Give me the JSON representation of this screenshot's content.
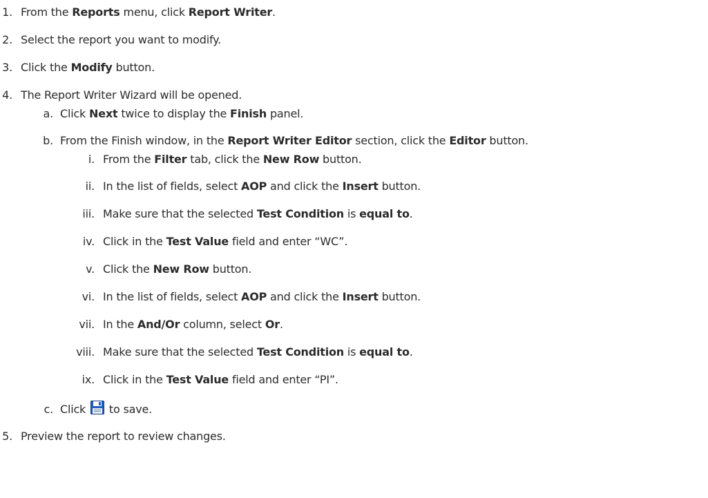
{
  "steps": [
    {
      "num": "1.",
      "parts": [
        [
          "From the ",
          false
        ],
        [
          "Reports",
          true
        ],
        [
          " menu, click ",
          false
        ],
        [
          "Report Writer",
          true
        ],
        [
          ".",
          false
        ]
      ]
    },
    {
      "num": "2.",
      "parts": [
        [
          "Select the report you want to modify.",
          false
        ]
      ]
    },
    {
      "num": "3.",
      "parts": [
        [
          "Click the ",
          false
        ],
        [
          "Modify",
          true
        ],
        [
          " button.",
          false
        ]
      ]
    },
    {
      "num": "4.",
      "parts": [
        [
          "The Report Writer Wizard will be opened.",
          false
        ]
      ]
    },
    {
      "num": "a.",
      "parts": [
        [
          "Click ",
          false
        ],
        [
          "Next",
          true
        ],
        [
          " twice to display the ",
          false
        ],
        [
          "Finish",
          true
        ],
        [
          " panel.",
          false
        ]
      ]
    },
    {
      "num": "b.",
      "parts": [
        [
          "From the Finish window, in the ",
          false
        ],
        [
          "Report Writer Editor",
          true
        ],
        [
          " section, click the ",
          false
        ],
        [
          "Editor",
          true
        ],
        [
          " button.",
          false
        ]
      ]
    },
    {
      "num": "i.",
      "parts": [
        [
          "From the ",
          false
        ],
        [
          "Filter",
          true
        ],
        [
          " tab, click the ",
          false
        ],
        [
          "New Row",
          true
        ],
        [
          " button.",
          false
        ]
      ]
    },
    {
      "num": "ii.",
      "parts": [
        [
          "In the list of fields, select ",
          false
        ],
        [
          "AOP",
          true
        ],
        [
          " and click the ",
          false
        ],
        [
          "Insert",
          true
        ],
        [
          " button.",
          false
        ]
      ]
    },
    {
      "num": "iii.",
      "parts": [
        [
          "Make sure that the selected ",
          false
        ],
        [
          "Test Condition",
          true
        ],
        [
          " is ",
          false
        ],
        [
          "equal to",
          true
        ],
        [
          ".",
          false
        ]
      ]
    },
    {
      "num": "iv.",
      "parts": [
        [
          "Click in the ",
          false
        ],
        [
          "Test Value",
          true
        ],
        [
          " field and enter “WC”.",
          false
        ]
      ]
    },
    {
      "num": "v.",
      "parts": [
        [
          "Click the ",
          false
        ],
        [
          "New Row",
          true
        ],
        [
          " button.",
          false
        ]
      ]
    },
    {
      "num": "vi.",
      "parts": [
        [
          "In the list of fields, select ",
          false
        ],
        [
          "AOP",
          true
        ],
        [
          " and click the ",
          false
        ],
        [
          "Insert",
          true
        ],
        [
          " button.",
          false
        ]
      ]
    },
    {
      "num": "vii.",
      "parts": [
        [
          "In the ",
          false
        ],
        [
          "And/Or",
          true
        ],
        [
          " column, select ",
          false
        ],
        [
          "Or",
          true
        ],
        [
          ".",
          false
        ]
      ]
    },
    {
      "num": "viii.",
      "parts": [
        [
          "Make sure that the selected ",
          false
        ],
        [
          "Test Condition",
          true
        ],
        [
          " is ",
          false
        ],
        [
          "equal to",
          true
        ],
        [
          ".",
          false
        ]
      ]
    },
    {
      "num": "ix.",
      "parts": [
        [
          "Click in the ",
          false
        ],
        [
          "Test Value",
          true
        ],
        [
          " field and enter “PI”.",
          false
        ]
      ]
    },
    {
      "num": "c.",
      "parts": [
        [
          "Click ",
          false
        ],
        [
          "",
          "icon"
        ],
        [
          " to save.",
          false
        ]
      ]
    },
    {
      "num": "5.",
      "parts": [
        [
          "Preview the report to review changes.",
          false
        ]
      ]
    }
  ],
  "icons": {
    "save": "save-floppy-icon"
  }
}
